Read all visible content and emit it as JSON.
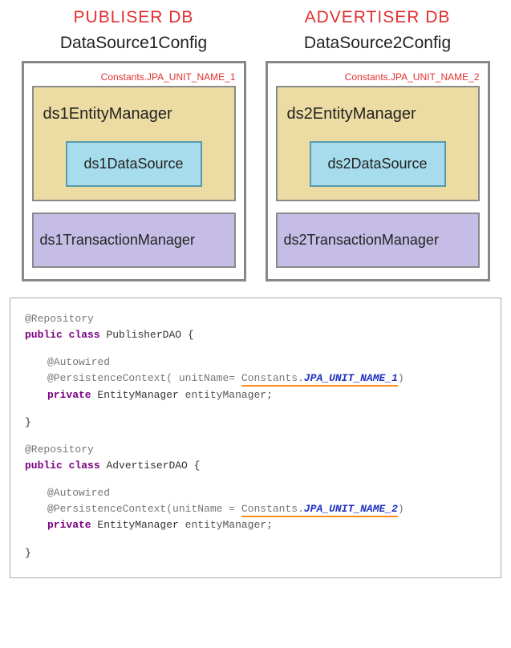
{
  "columns": [
    {
      "db_title": "PUBLISER DB",
      "config_title": "DataSource1Config",
      "jpa_label": "Constants.JPA_UNIT_NAME_1",
      "entity_manager": "ds1EntityManager",
      "data_source": "ds1DataSource",
      "transaction_manager": "ds1TransactionManager"
    },
    {
      "db_title": "ADVERTISER  DB",
      "config_title": "DataSource2Config",
      "jpa_label": "Constants.JPA_UNIT_NAME_2",
      "entity_manager": "ds2EntityManager",
      "data_source": "ds2DataSource",
      "transaction_manager": "ds2TransactionManager"
    }
  ],
  "code": {
    "repo_ann": "@Repository",
    "public_class": "public class",
    "class1": "PublisherDAO {",
    "class2": "AdvertiserDAO  {",
    "autowired": "@Autowired",
    "pctx_open": "@PersistenceContext",
    "unit_eq1": "( unitName= ",
    "unit_eq2": "(unitName = ",
    "constants": "Constants.",
    "jpa1": "JPA_UNIT_NAME_1",
    "jpa2": "JPA_UNIT_NAME_2",
    "paren_close": ")",
    "private": "private",
    "em_type": "EntityManager",
    "em_field": "entityManager;",
    "brace_close": "}"
  }
}
